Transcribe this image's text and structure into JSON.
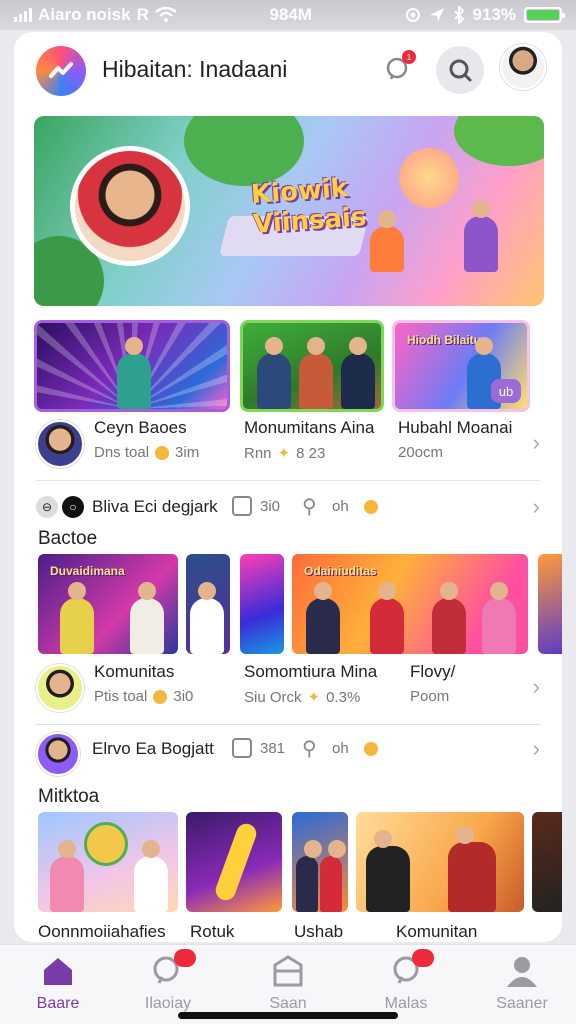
{
  "status_bar": {
    "carrier": "Aiaro noisk",
    "network": "R",
    "time": "984M",
    "battery_pct": "913%",
    "battery_level": 1.0
  },
  "header": {
    "title": "Hibaitan: Inadaani",
    "notification_badge": "1"
  },
  "hero": {
    "title_line1": "Kiowik",
    "title_line2": "Viinsais"
  },
  "thumb_row": {
    "play_badge": "ub",
    "items": [
      {
        "title": "Ceyn Baoes",
        "sub": "Dns toal",
        "sub2": "3im"
      },
      {
        "title": "Monumitans Aina",
        "sub": "Rnn",
        "sub2": "8 23"
      },
      {
        "title": "Hubahl Moanai",
        "sub": "20ocm",
        "sub2": ""
      }
    ],
    "thumb_labels": [
      "",
      "",
      "Hiodh Bilaitur"
    ]
  },
  "chip_row_1": {
    "text": "Bliva Eci degjark",
    "count1": "3i0",
    "count2": "oh"
  },
  "section_1": {
    "title": "Bactoe",
    "tiles": [
      {
        "label": "Duvaidimana"
      },
      {
        "label": ""
      },
      {
        "label": ""
      },
      {
        "label": "Odainiuditas"
      },
      {
        "label": ""
      }
    ],
    "meta": [
      {
        "title": "Komunitas",
        "sub": "Ptis toal",
        "sub2": "3i0"
      },
      {
        "title": "Somomtiura Mina",
        "sub": "Siu Orck",
        "sub2": "0.3%"
      },
      {
        "title": "Flovy/",
        "sub": "Poom",
        "sub2": ""
      }
    ]
  },
  "chip_row_2": {
    "text": "Elrvo Ea Bogjatt",
    "count1": "381",
    "count2": "oh"
  },
  "section_2": {
    "title": "Mitktoa",
    "tiles": [
      {
        "label": ""
      },
      {
        "label": ""
      },
      {
        "label": ""
      },
      {
        "label": ""
      },
      {
        "label": ""
      }
    ],
    "captions": [
      "Oonnmoiiahafies",
      "Rotuk",
      "Ushab",
      "Komunitan"
    ]
  },
  "nav": {
    "items": [
      {
        "label": "Baare",
        "icon": "home-icon",
        "active": true
      },
      {
        "label": "Ilaoiay",
        "icon": "chat-search-icon",
        "active": false
      },
      {
        "label": "Saan",
        "icon": "store-icon",
        "active": false
      },
      {
        "label": "Malas",
        "icon": "notification-icon",
        "active": false
      },
      {
        "label": "Saaner",
        "icon": "profile-icon",
        "active": false
      }
    ]
  },
  "colors": {
    "accent": "#7a3ca8",
    "badge": "#ee2b3b",
    "inactive": "#9b9ba3"
  }
}
